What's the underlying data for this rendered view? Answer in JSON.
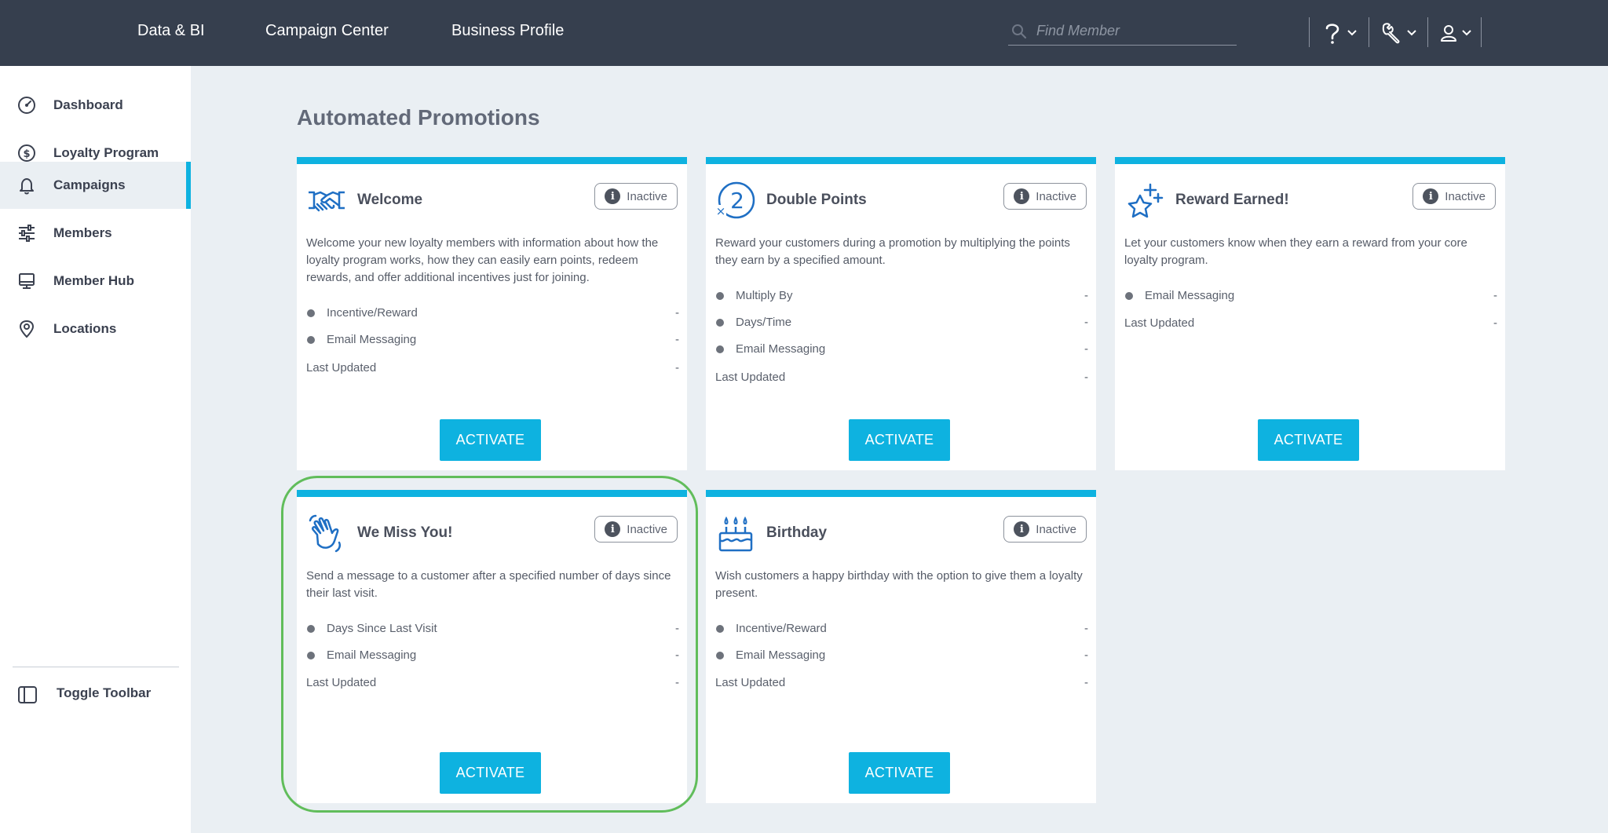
{
  "header": {
    "nav": [
      {
        "label": "Data & BI"
      },
      {
        "label": "Campaign Center"
      },
      {
        "label": "Business Profile"
      }
    ],
    "search": {
      "placeholder": "Find Member",
      "value": ""
    }
  },
  "sidebar": {
    "items": [
      {
        "label": "Dashboard",
        "icon": "dashboard-gauge-icon"
      },
      {
        "label": "Loyalty Program",
        "icon": "dollar-coin-icon"
      },
      {
        "label": "Campaigns",
        "icon": "bell-icon",
        "active": true
      },
      {
        "label": "Members",
        "icon": "sliders-icon"
      },
      {
        "label": "Member Hub",
        "icon": "monitor-icon"
      },
      {
        "label": "Locations",
        "icon": "map-pin-icon"
      }
    ],
    "toggle_label": "Toggle Toolbar"
  },
  "main": {
    "title": "Automated Promotions",
    "cards": [
      {
        "title": "Welcome",
        "icon": "handshake-icon",
        "status": "Inactive",
        "description": "Welcome your new loyalty members with information about how the loyalty program works, how they can easily earn points, redeem rewards, and offer additional incentives just for joining.",
        "features": [
          {
            "label": "Incentive/Reward",
            "value": "-"
          },
          {
            "label": "Email Messaging",
            "value": "-"
          }
        ],
        "last_updated_label": "Last Updated",
        "last_updated_value": "-",
        "button": "ACTIVATE"
      },
      {
        "title": "Double Points",
        "icon": "double-points-icon",
        "status": "Inactive",
        "description": "Reward your customers during a promotion by multiplying the points they earn by a specified amount.",
        "features": [
          {
            "label": "Multiply By",
            "value": "-"
          },
          {
            "label": "Days/Time",
            "value": "-"
          },
          {
            "label": "Email Messaging",
            "value": "-"
          }
        ],
        "last_updated_label": "Last Updated",
        "last_updated_value": "-",
        "button": "ACTIVATE"
      },
      {
        "title": "Reward Earned!",
        "icon": "star-sparkle-icon",
        "status": "Inactive",
        "description": "Let your customers know when they earn a reward from your core loyalty program.",
        "features": [
          {
            "label": "Email Messaging",
            "value": "-"
          }
        ],
        "last_updated_label": "Last Updated",
        "last_updated_value": "-",
        "button": "ACTIVATE"
      },
      {
        "title": "We Miss You!",
        "icon": "waving-hand-icon",
        "status": "Inactive",
        "description": "Send a message to a customer after a specified number of days since their last visit.",
        "features": [
          {
            "label": "Days Since Last Visit",
            "value": "-"
          },
          {
            "label": "Email Messaging",
            "value": "-"
          }
        ],
        "last_updated_label": "Last Updated",
        "last_updated_value": "-",
        "button": "ACTIVATE"
      },
      {
        "title": "Birthday",
        "icon": "birthday-cake-icon",
        "status": "Inactive",
        "description": "Wish customers a happy birthday with the option to give them a loyalty present.",
        "features": [
          {
            "label": "Incentive/Reward",
            "value": "-"
          },
          {
            "label": "Email Messaging",
            "value": "-"
          }
        ],
        "last_updated_label": "Last Updated",
        "last_updated_value": "-",
        "button": "ACTIVATE"
      }
    ]
  },
  "colors": {
    "header_bg": "#363f4e",
    "accent": "#0eb2e0",
    "page_bg": "#eaeff3",
    "highlight": "#61bd5b",
    "icon_blue": "#1f6fc4"
  }
}
